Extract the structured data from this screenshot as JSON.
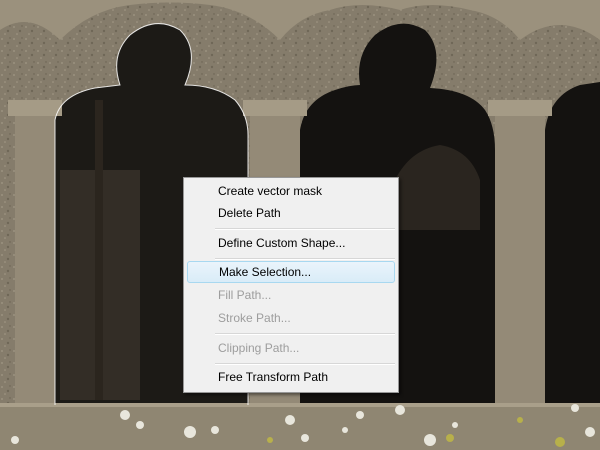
{
  "canvas": {
    "subject": "stone-gothic-arcade-photo",
    "selection": "path-outline-on-left-arch"
  },
  "context_menu": {
    "items": [
      {
        "label": "Create vector mask",
        "enabled": true,
        "highlighted": false
      },
      {
        "label": "Delete Path",
        "enabled": true,
        "highlighted": false
      },
      {
        "label": "Define Custom Shape...",
        "enabled": true,
        "highlighted": false
      },
      {
        "label": "Make Selection...",
        "enabled": true,
        "highlighted": true
      },
      {
        "label": "Fill Path...",
        "enabled": false,
        "highlighted": false
      },
      {
        "label": "Stroke Path...",
        "enabled": false,
        "highlighted": false
      },
      {
        "label": "Clipping Path...",
        "enabled": false,
        "highlighted": false
      },
      {
        "label": "Free Transform Path",
        "enabled": true,
        "highlighted": false
      }
    ]
  },
  "colors": {
    "stone": "#8a8170",
    "shadow": "#141210",
    "lichen": "#e8e6dc",
    "menu_bg": "#f0f0f0",
    "highlight_border": "#a8d8f0"
  }
}
